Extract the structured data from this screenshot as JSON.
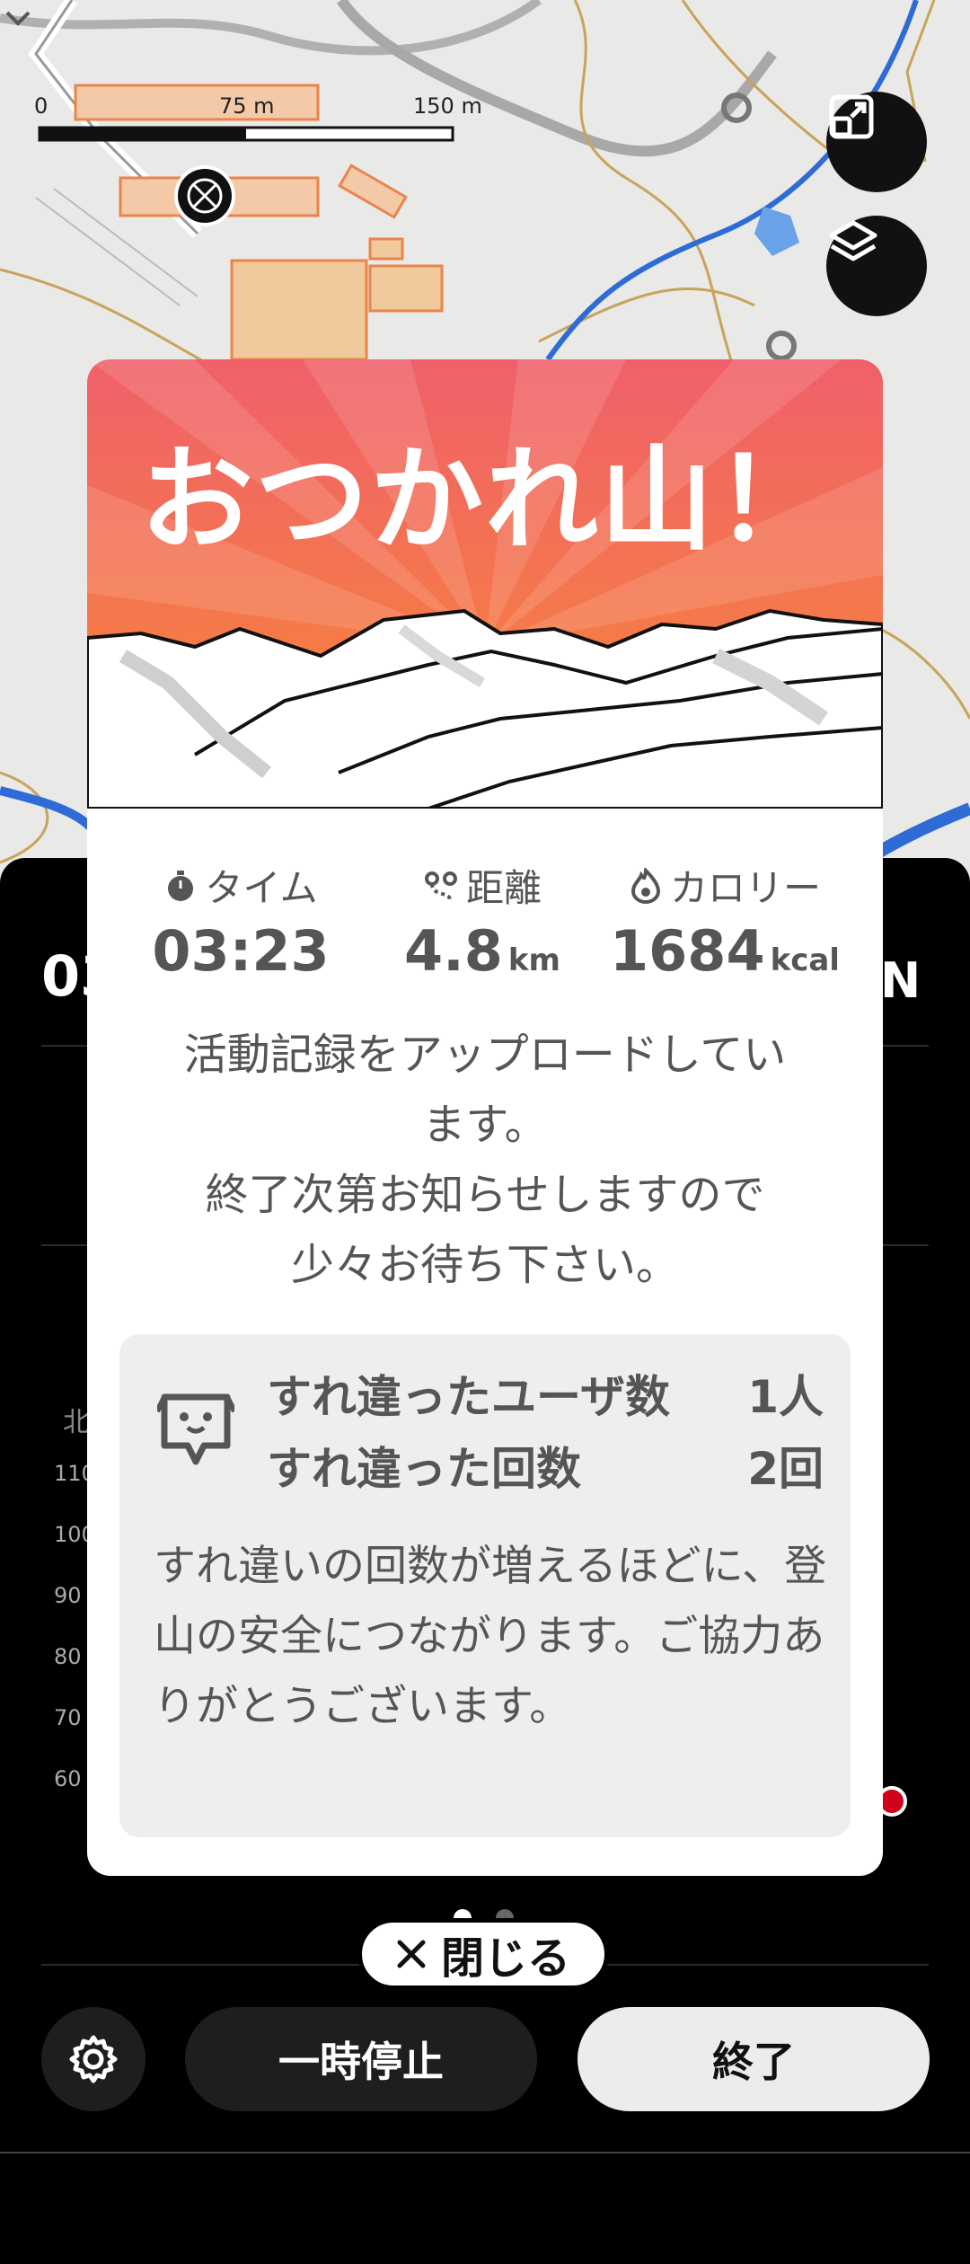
{
  "map": {
    "scale": {
      "zero": "0",
      "mid": "75 m",
      "max": "150 m"
    }
  },
  "background": {
    "time_partial": "03",
    "north_partial": "北",
    "axis_values": [
      "110",
      "100",
      "90",
      "80",
      "70",
      "60"
    ],
    "compass_letter": "N"
  },
  "modal": {
    "title": "おつかれ山！",
    "stats": {
      "time": {
        "label": "タイム",
        "value": "03:23"
      },
      "distance": {
        "label": "距離",
        "value": "4.8",
        "unit": "km"
      },
      "calories": {
        "label": "カロリー",
        "value": "1684",
        "unit": "kcal"
      }
    },
    "message_line1": "活動記録をアップロードしてい",
    "message_line2": "ます。",
    "message_line3": "終了次第お知らせしますので",
    "message_line4": "少々お待ち下さい。",
    "pass": {
      "users_label": "すれ違ったユーザ数",
      "users_value": "1人",
      "count_label": "すれ違った回数",
      "count_value": "2回",
      "note": "すれ違いの回数が増えるほどに、登山の安全につながります。ご協力ありがとうございます。"
    }
  },
  "close_button": {
    "icon": "close-icon",
    "label": "閉じる"
  },
  "controls": {
    "settings_icon": "gear-icon",
    "pause_label": "一時停止",
    "end_label": "終了"
  },
  "colors": {
    "banner_top": "#f0606a",
    "banner_bottom": "#f88a34",
    "accent_red": "#d0021b"
  }
}
